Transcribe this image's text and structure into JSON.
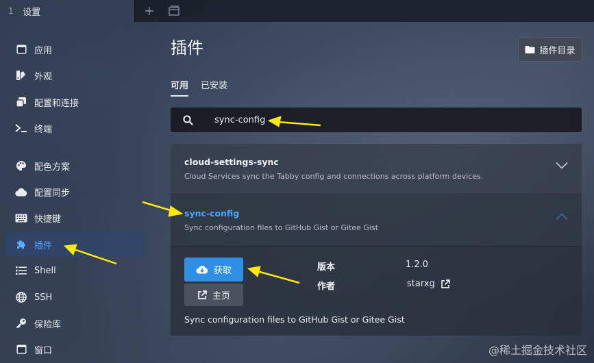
{
  "window": {
    "tab_index": "1",
    "tab_title": "设置"
  },
  "sidebar": {
    "items": [
      {
        "label": "应用",
        "icon": "window-icon"
      },
      {
        "label": "外观",
        "icon": "appearance-icon"
      },
      {
        "label": "配置和连接",
        "icon": "profiles-icon"
      },
      {
        "label": "终端",
        "icon": "terminal-icon"
      },
      {
        "label": "配色方案",
        "icon": "palette-icon"
      },
      {
        "label": "配置同步",
        "icon": "cloud-icon"
      },
      {
        "label": "快捷键",
        "icon": "keyboard-icon"
      },
      {
        "label": "插件",
        "icon": "puzzle-icon",
        "active": true
      },
      {
        "label": "Shell",
        "icon": "list-icon"
      },
      {
        "label": "SSH",
        "icon": "globe-icon"
      },
      {
        "label": "保险库",
        "icon": "key-icon"
      },
      {
        "label": "窗口",
        "icon": "window-icon"
      }
    ]
  },
  "main": {
    "title": "插件",
    "plugin_dir_button": "插件目录",
    "tabs": [
      {
        "label": "可用",
        "active": true
      },
      {
        "label": "已安装",
        "active": false
      }
    ],
    "search": {
      "value": "sync-config"
    },
    "plugins": [
      {
        "name": "cloud-settings-sync",
        "description": "Cloud Services sync the Tabby config and connections across platform devices.",
        "expanded": false
      },
      {
        "name": "sync-config",
        "description": "Sync configuration files to GitHub Gist or Gitee Gist",
        "expanded": true
      }
    ],
    "detail": {
      "get_button": "获取",
      "home_button": "主页",
      "version_label": "版本",
      "version_value": "1.2.0",
      "author_label": "作者",
      "author_value": "starxg",
      "description": "Sync configuration files to GitHub Gist or Gitee Gist"
    }
  },
  "watermark": "@稀土掘金技术社区",
  "colors": {
    "accent": "#2d8fe6",
    "active_text": "#59a9ff",
    "annotation_arrow": "#ffea00"
  }
}
